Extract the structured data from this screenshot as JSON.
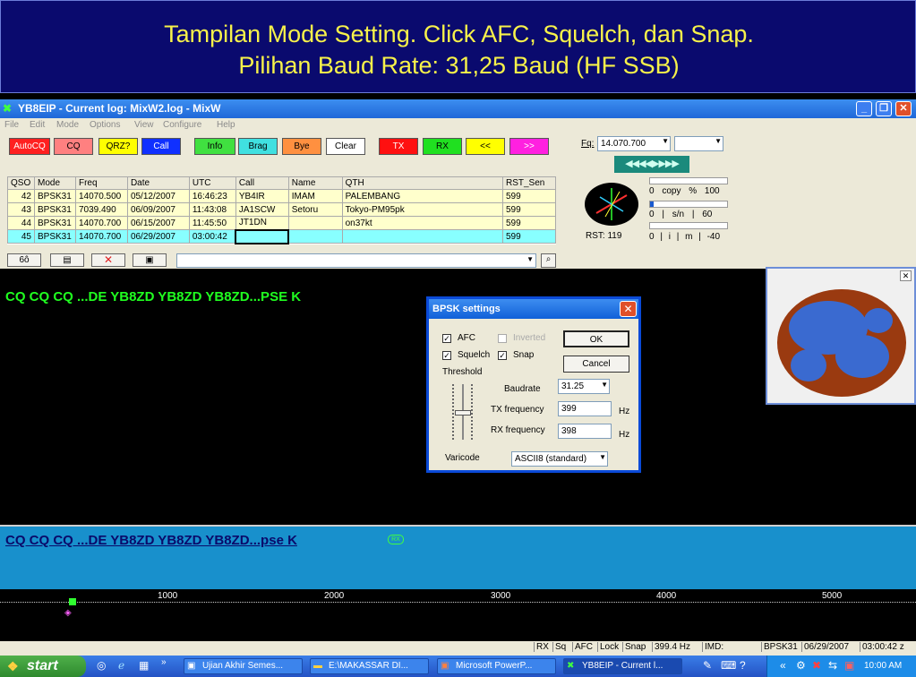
{
  "slide": {
    "line1": "Tampilan Mode Setting. Click AFC, Squelch, dan Snap.",
    "line2": "Pilihan Baud Rate: 31,25 Baud (HF SSB)"
  },
  "window": {
    "title": "YB8EIP - Current log: MixW2.log - MixW",
    "buttons": [
      "_",
      "❐",
      "✕"
    ]
  },
  "menu": [
    "File",
    "Edit",
    "Mode",
    "Options",
    "View",
    "Configure",
    "Help"
  ],
  "toolbar": {
    "buttons": [
      {
        "label": "AutoCQ",
        "color": "#ff2020",
        "text": "#ffffff"
      },
      {
        "label": "CQ",
        "color": "#ff8080",
        "text": "#000000"
      },
      {
        "label": "QRZ?",
        "color": "#ffff00",
        "text": "#000000"
      },
      {
        "label": "Call",
        "color": "#1030ff",
        "text": "#ffffff"
      },
      {
        "label": "Info",
        "color": "#40e040",
        "text": "#000000"
      },
      {
        "label": "Brag",
        "color": "#40e0e0",
        "text": "#000000"
      },
      {
        "label": "Bye",
        "color": "#ff9040",
        "text": "#000000"
      },
      {
        "label": "Clear",
        "color": "#ffffff",
        "text": "#000000"
      },
      {
        "label": "TX",
        "color": "#ff1010",
        "text": "#ffffff"
      },
      {
        "label": "RX",
        "color": "#20e020",
        "text": "#000000"
      },
      {
        "label": "<<",
        "color": "#ffff00",
        "text": "#000000"
      },
      {
        "label": ">>",
        "color": "#ff20e0",
        "text": "#ffffff"
      }
    ]
  },
  "freq": {
    "label": "Fq:",
    "value": "14.070.700",
    "tune_arrows": "◀◀◀◀▶▶▶▶"
  },
  "meters": {
    "rst": "RST: 119",
    "copy_label": "0 copy % 100",
    "sn_label": "0 | s/n | 60",
    "imd_label": "0 | i | m | -40"
  },
  "log": {
    "columns": [
      "QSO",
      "Mode",
      "Freq",
      "Date",
      "UTC",
      "Call",
      "Name",
      "QTH",
      "RST_Sen"
    ],
    "rows": [
      [
        "42",
        "BPSK31",
        "14070.500",
        "05/12/2007",
        "16:46:23",
        "YB4IR",
        "IMAM",
        "PALEMBANG",
        "599"
      ],
      [
        "43",
        "BPSK31",
        "7039.490",
        "06/09/2007",
        "11:43:08",
        "JA1SCW",
        "Setoru",
        "Tokyo-PM95pk",
        "599"
      ],
      [
        "44",
        "BPSK31",
        "14070.700",
        "06/15/2007",
        "11:45:50",
        "JT1DN",
        "",
        "on37kt",
        "599"
      ],
      [
        "45",
        "BPSK31",
        "14070.700",
        "06/29/2007",
        "03:00:42",
        "",
        "",
        "",
        "599"
      ]
    ]
  },
  "rx_text": "CQ CQ CQ ...DE YB8ZD YB8ZD YB8ZD...PSE K",
  "tx_text": "CQ CQ CQ ...DE YB8ZD YB8ZD YB8ZD...pse K",
  "tx_marker": "RX",
  "waterfall": {
    "ticks": [
      "1000",
      "2000",
      "3000",
      "4000",
      "5000"
    ]
  },
  "dialog": {
    "title": "BPSK settings",
    "afc": "AFC",
    "inverted": "Inverted",
    "squelch": "Squelch",
    "snap": "Snap",
    "threshold": "Threshold",
    "baudrate_label": "Baudrate",
    "baudrate": "31.25",
    "tx_label": "TX frequency",
    "tx_value": "399",
    "rx_label": "RX frequency",
    "rx_value": "398",
    "hz": "Hz",
    "varicode_label": "Varicode",
    "varicode": "ASCII8 (standard)",
    "ok": "OK",
    "cancel": "Cancel"
  },
  "status": [
    "RX",
    "Sq",
    "AFC",
    "Lock",
    "Snap",
    "399.4 Hz",
    "IMD:",
    "BPSK31",
    "06/29/2007",
    "03:00:42 z"
  ],
  "taskbar": {
    "start": "start",
    "tasks": [
      "Ujian Akhir Semes...",
      "E:\\MAKASSAR DI...",
      "Microsoft PowerP...",
      "YB8EIP - Current l..."
    ],
    "clock": "10:00 AM"
  }
}
